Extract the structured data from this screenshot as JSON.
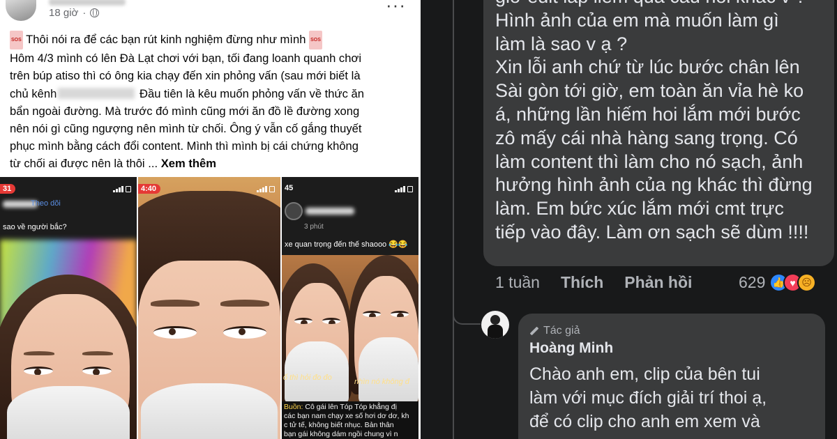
{
  "post": {
    "time": "18 giờ",
    "sos": "SOS",
    "lines": [
      "Thôi nói ra để các bạn rút kinh nghiệm đừng như mình",
      "Hôm 4/3 mình có lên Đà Lạt chơi với bạn, tối đang loanh quanh chơi",
      "trên búp atiso thì có ông kia chạy đến xin phỏng vấn (sau mới biết là",
      "chủ kênh",
      "Đầu tiên là kêu muốn phỏng vấn về thức ăn",
      "bẩn ngoài đường. Mà trước đó mình cũng mới ăn đồ lề đường xong",
      "nên nói gì cũng ngượng nên mình từ chối. Ông ý vẫn cố gắng thuyết",
      "phục mình bằng cách đổi content. Mình thì mình bị cái chứng không",
      "từ chối ai được nên là thôi ..."
    ],
    "see_more": "Xem thêm"
  },
  "photos": {
    "p1_time": "31",
    "p1_follow": "Theo dõi",
    "p1_question": "sao về người bắc?",
    "p2_time": "4:40",
    "p3_time": "45",
    "p3_meta": "3 phút",
    "p3_caption": "xe quan trọng đến thế shaooo 😂😂",
    "p3_sub_left": "ố thì hỏi đo đo",
    "p3_sub_right": "nhìn nó không đ",
    "p3_news_lead": "Buồn:",
    "p3_news_lines": [
      " Cô gái lên Tóp Tóp khẳng đị",
      "các bạn nam chạy xe số hơi dơ dơ, kh",
      "c tử tế, không biết nhục. Bản thân",
      "bạn gái không dám ngồi chung vì n"
    ]
  },
  "comment": {
    "lines": [
      "giờ edit lấp liếm qua câu hỏi khác v ?",
      "Hình ảnh của em mà muốn làm gì",
      "làm là sao v ạ ?",
      "Xin lỗi anh chứ từ lúc bước chân lên",
      "Sài gòn tới giờ, em toàn ăn vỉa hè ko",
      "á, những lần hiếm hoi lắm mới bước",
      "zô mấy cái nhà hàng sang trọng. Có",
      "làm content thì làm cho nó sạch, ảnh",
      "hưởng hình ảnh của ng khác thì đừng",
      "làm. Em bức xúc lắm mới cmt trực",
      "tiếp vào đây. Làm ơn sạch sẽ dùm !!!!"
    ],
    "time": "1 tuần",
    "like": "Thích",
    "reply": "Phản hồi",
    "reaction_count": "629",
    "reaction_icons": [
      "like-icon",
      "love-icon",
      "sad-icon"
    ],
    "colors": {
      "like": "#2d88ff",
      "love": "#f33e58",
      "sad": "#f7b125"
    }
  },
  "reply": {
    "tag": "Tác giả",
    "author": "Hoàng Minh",
    "lines": [
      "Chào anh em, clip của bên tui",
      "làm với mục đích giải trí thoi ạ,",
      "để có clip cho anh em xem và"
    ]
  }
}
